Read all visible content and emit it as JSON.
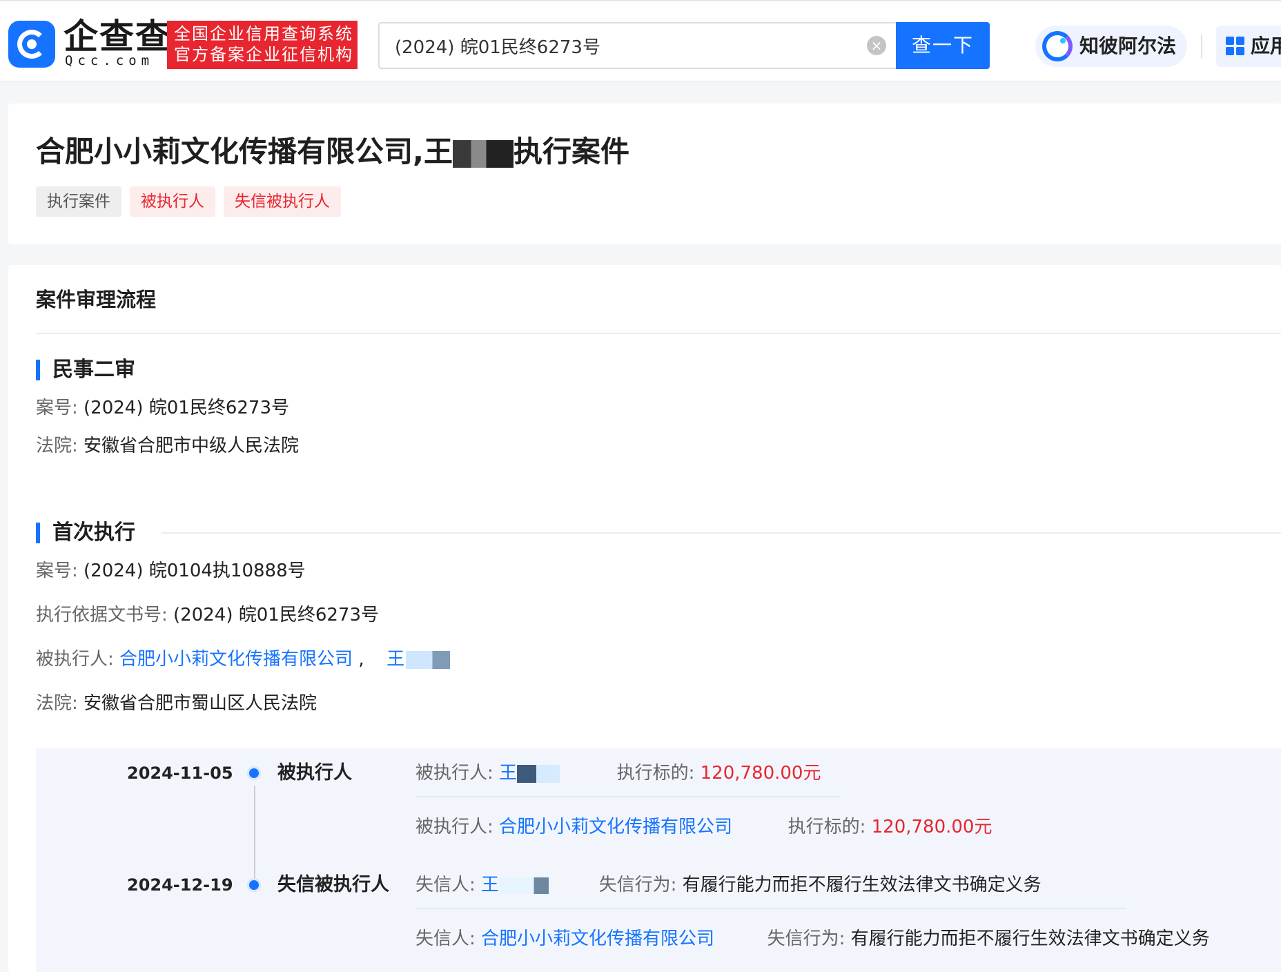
{
  "header": {
    "logo_name": "企查查",
    "logo_domain": "Qcc.com",
    "badge_line1": "全国企业信用查询系统",
    "badge_line2": "官方备案企业征信机构",
    "search_value": "(2024) 皖01民终6273号",
    "search_button": "查一下",
    "zhibi_label": "知彼阿尔法",
    "apps_label": "应用"
  },
  "title_card": {
    "title_before": "合肥小小莉文化传播有限公司,王",
    "title_after": "执行案件",
    "tags": [
      "执行案件",
      "被执行人",
      "失信被执行人"
    ]
  },
  "process": {
    "section_title": "案件审理流程",
    "stage1": {
      "title": "民事二审",
      "case_label": "案号:",
      "case_value": "(2024) 皖01民终6273号",
      "court_label": "法院:",
      "court_value": "安徽省合肥市中级人民法院"
    },
    "stage2": {
      "title": "首次执行",
      "case_label": "案号:",
      "case_value": "(2024) 皖0104执10888号",
      "basis_label": "执行依据文书号:",
      "basis_value": "(2024) 皖01民终6273号",
      "party_label": "被执行人:",
      "party_company": "合肥小小莉文化传播有限公司",
      "party_sep": ",",
      "party_person": "王",
      "court_label": "法院:",
      "court_value": "安徽省合肥市蜀山区人民法院"
    },
    "timeline": [
      {
        "date": "2024-11-05",
        "type": "被执行人",
        "entries": [
          {
            "label": "被执行人:",
            "name": "王",
            "amount_label": "执行标的:",
            "amount": "120,780.00元"
          },
          {
            "label": "被执行人:",
            "name": "合肥小小莉文化传播有限公司",
            "amount_label": "执行标的:",
            "amount": "120,780.00元"
          }
        ]
      },
      {
        "date": "2024-12-19",
        "type": "失信被执行人",
        "entries": [
          {
            "label": "失信人:",
            "name": "王",
            "behavior_label": "失信行为:",
            "behavior": "有履行能力而拒不履行生效法律文书确定义务"
          },
          {
            "label": "失信人:",
            "name": "合肥小小莉文化传播有限公司",
            "behavior_label": "失信行为:",
            "behavior": "有履行能力而拒不履行生效法律文书确定义务"
          }
        ]
      }
    ]
  },
  "colors": {
    "brand_blue": "#1673ff",
    "brand_red": "#e8262f",
    "panel_bg": "#f2f6fc"
  }
}
